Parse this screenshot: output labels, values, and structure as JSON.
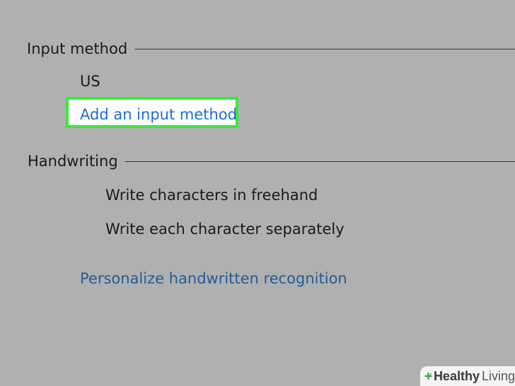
{
  "sections": {
    "input_method": {
      "title": "Input method",
      "items": [
        "US"
      ],
      "add_link": "Add an input method"
    },
    "handwriting": {
      "title": "Handwriting",
      "options": [
        "Write characters in freehand",
        "Write each character separately"
      ],
      "personalize_link": "Personalize handwritten recognition"
    }
  },
  "highlight": {
    "color": "#3ce83c"
  },
  "watermark": {
    "brand_bold": "Healthy",
    "brand_light": "Living",
    "icon": "plus-leaf-icon"
  }
}
